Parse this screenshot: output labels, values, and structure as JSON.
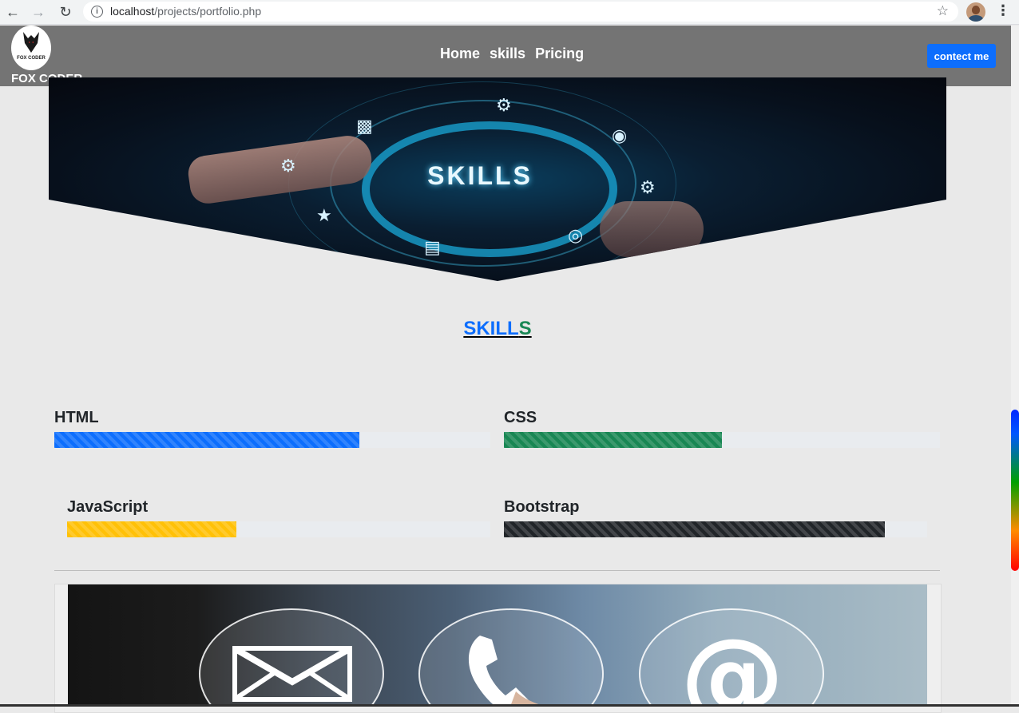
{
  "browser": {
    "url_host": "localhost",
    "url_path": "/projects/portfolio.php"
  },
  "site": {
    "logo_text": "FOX CODER",
    "logo_small": "FOX CODER",
    "nav_links": [
      "Home",
      "skills",
      "Pricing"
    ],
    "contact_button": "contect me"
  },
  "hero": {
    "text": "SKILLS"
  },
  "skills": {
    "title_main": "SKILL",
    "title_last": "S",
    "items": [
      {
        "label": "HTML",
        "percent": 70,
        "color": "#0d6efd"
      },
      {
        "label": "CSS",
        "percent": 50,
        "color": "#198754"
      },
      {
        "label": "JavaScript",
        "percent": 40,
        "color": "#ffc107"
      },
      {
        "label": "Bootstrap",
        "percent": 90,
        "color": "#212529"
      }
    ]
  },
  "contact_icons": [
    "mail-icon",
    "phone-icon",
    "at-sign-icon"
  ]
}
